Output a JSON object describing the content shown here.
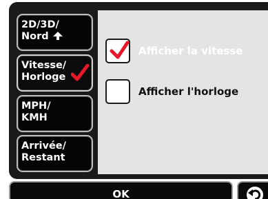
{
  "menu": {
    "items": [
      {
        "line1": "2D/3D/",
        "line2": "Nord",
        "icon": "arrow-up-icon"
      },
      {
        "line1": "Vitesse/",
        "line2": "Horloge",
        "icon": "checkmark-icon",
        "active": true
      },
      {
        "line1": "MPH/",
        "line2": "KMH"
      },
      {
        "line1": "Arrivée/",
        "line2": "Restant"
      }
    ]
  },
  "options": [
    {
      "label": "Afficher la vitesse",
      "checked": true
    },
    {
      "label": "Afficher l'horloge",
      "checked": false
    }
  ],
  "footer": {
    "ok_label": "OK",
    "back_icon": "back-arrow-icon"
  },
  "colors": {
    "frame": "#1a1a1a",
    "panel": "#e4e4e4",
    "check_red": "#e8172a",
    "button_border": "#bdbdbd"
  }
}
